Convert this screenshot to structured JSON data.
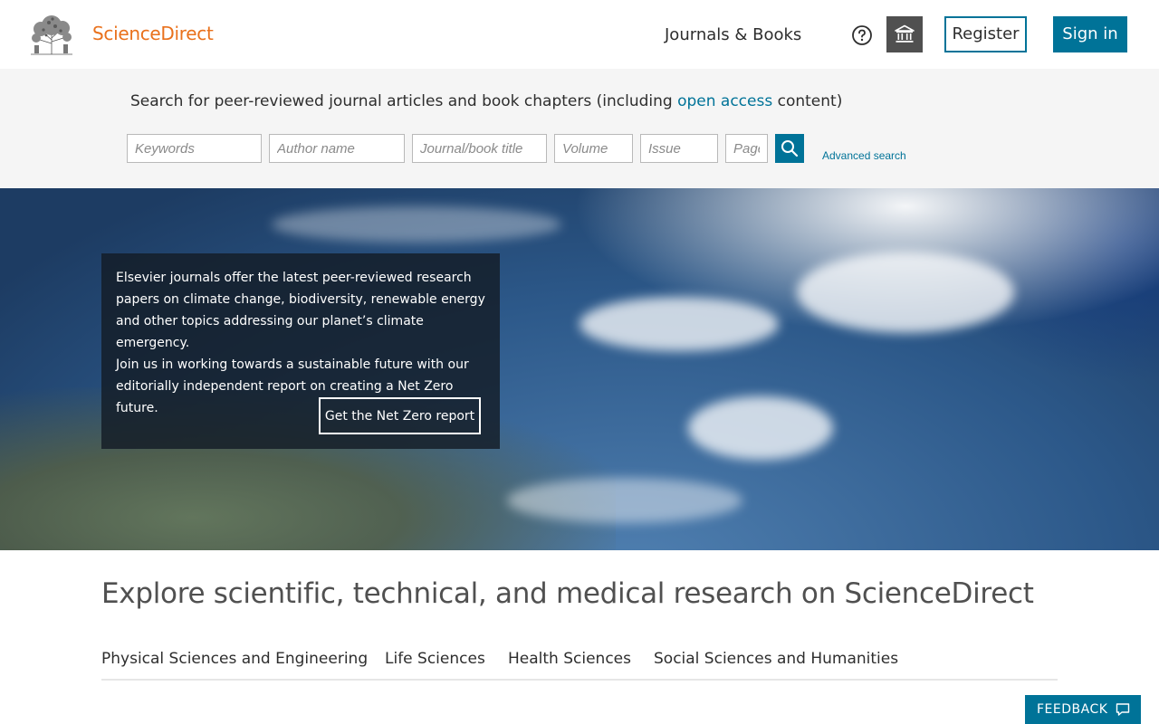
{
  "header": {
    "brand": "ScienceDirect",
    "nav_journals": "Journals & Books",
    "help_icon": "help-circle-icon",
    "institution_icon": "institution-icon",
    "register_label": "Register",
    "signin_label": "Sign in"
  },
  "search": {
    "intro_before": "Search for peer-reviewed journal articles and book chapters (including ",
    "intro_link": "open access",
    "intro_after": " content)",
    "fields": {
      "keywords": "Keywords",
      "author": "Author name",
      "journal": "Journal/book title",
      "volume": "Volume",
      "issue": "Issue",
      "pages": "Pages"
    },
    "submit_icon": "search-icon",
    "advanced_label": "Advanced search"
  },
  "hero": {
    "text_1": "Elsevier journals offer the latest peer-reviewed research papers on climate change, biodiversity, renewable energy and other topics addressing our planet’s climate emergency.",
    "text_2": "Join us in working towards a sustainable future with our editorially independent report on creating a Net Zero future.",
    "cta_label": "Get the Net Zero report"
  },
  "explore": {
    "title": "Explore scientific, technical, and medical research on ScienceDirect",
    "tabs": [
      {
        "label": "Physical Sciences and Engineering"
      },
      {
        "label": "Life Sciences"
      },
      {
        "label": "Health Sciences"
      },
      {
        "label": "Social Sciences and Humanities"
      }
    ]
  },
  "feedback": {
    "label": "FEEDBACK",
    "icon": "speech-bubble-icon"
  },
  "colors": {
    "brand_orange": "#e9711c",
    "accent_teal": "#007398",
    "search_band": "#f5f5f5"
  }
}
